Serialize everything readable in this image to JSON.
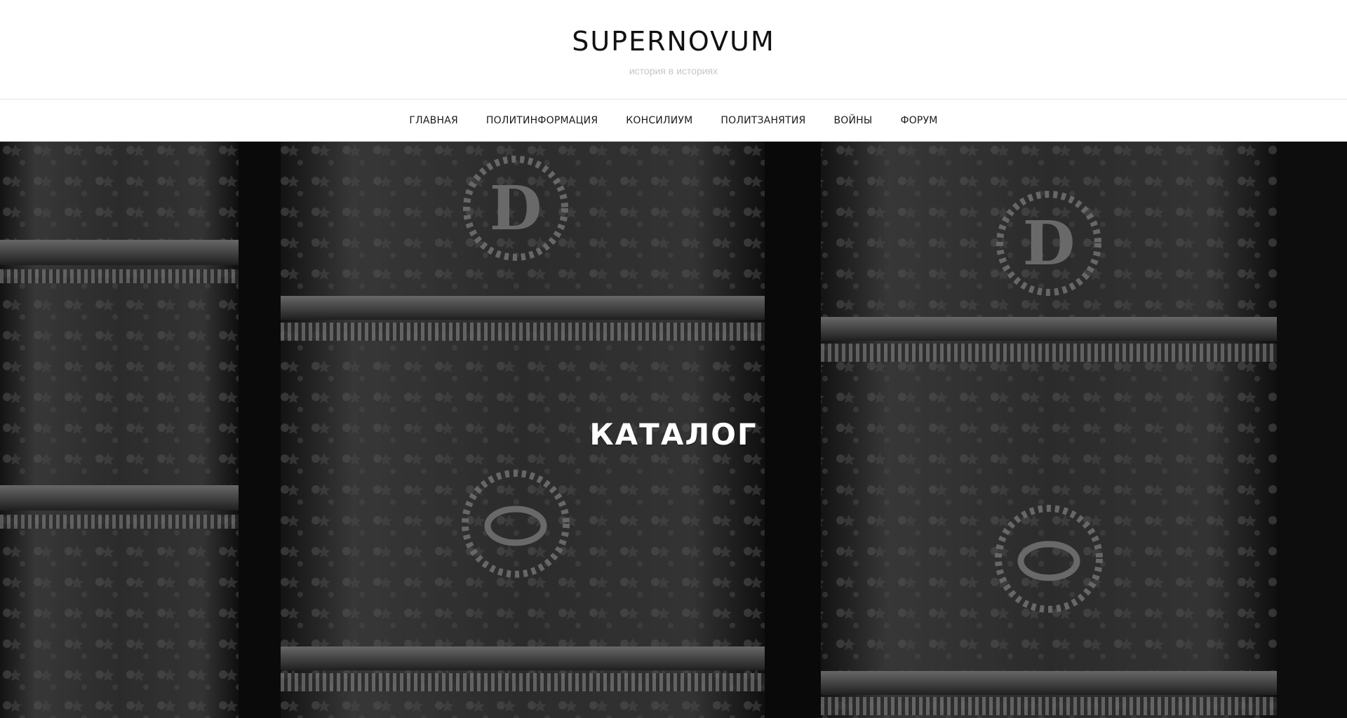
{
  "header": {
    "title": "SUPERNOVUM",
    "tagline": "история в историях"
  },
  "nav": {
    "items": [
      {
        "label": "ГЛАВНАЯ"
      },
      {
        "label": "ПОЛИТИНФОРМАЦИЯ"
      },
      {
        "label": "КОНСИЛИУМ"
      },
      {
        "label": "ПОЛИТЗАНЯТИЯ"
      },
      {
        "label": "ВОЙНЫ"
      },
      {
        "label": "ФОРУМ"
      }
    ]
  },
  "hero": {
    "title": "КАТАЛОГ",
    "image": "antique-book-spines-photo"
  },
  "colors": {
    "title": "#111111",
    "tagline": "#c6c6c6",
    "nav_text": "#1a1a1a",
    "hero_text": "#ffffff",
    "divider": "#e4e4e4"
  }
}
